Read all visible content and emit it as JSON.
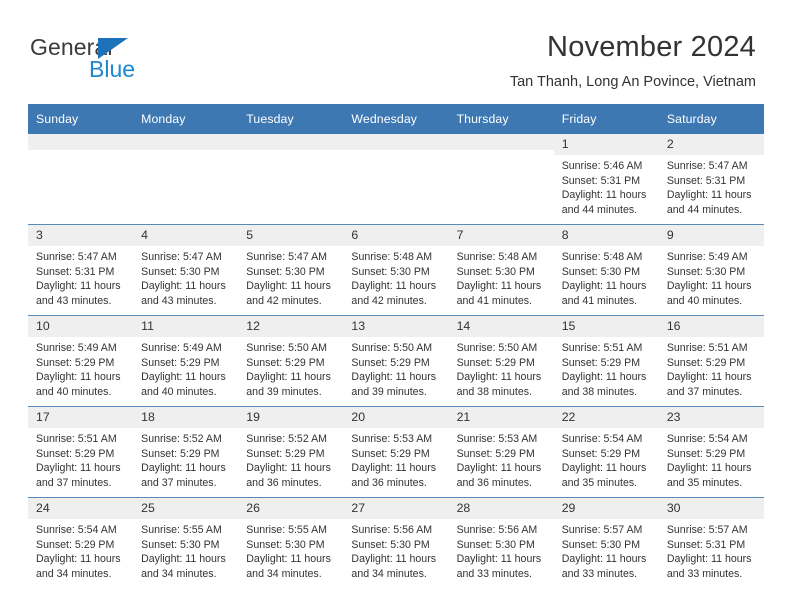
{
  "brand": {
    "name_part1": "General",
    "name_part2": "Blue",
    "triangle_color": "#1d71b8",
    "blue_color": "#1f86d0"
  },
  "header": {
    "title": "November 2024",
    "location": "Tan Thanh, Long An Povince, Vietnam"
  },
  "theme": {
    "header_blue": "#3d78b2",
    "row_divider": "#5b89b8",
    "daynum_band": "#efefef",
    "text": "#333333"
  },
  "calendar": {
    "weekday_headers": [
      "Sunday",
      "Monday",
      "Tuesday",
      "Wednesday",
      "Thursday",
      "Friday",
      "Saturday"
    ],
    "weeks": [
      [
        {
          "day": "",
          "empty": true
        },
        {
          "day": "",
          "empty": true
        },
        {
          "day": "",
          "empty": true
        },
        {
          "day": "",
          "empty": true
        },
        {
          "day": "",
          "empty": true
        },
        {
          "day": "1",
          "sunrise": "Sunrise: 5:46 AM",
          "sunset": "Sunset: 5:31 PM",
          "daylight_line1": "Daylight: 11 hours",
          "daylight_line2": "and 44 minutes."
        },
        {
          "day": "2",
          "sunrise": "Sunrise: 5:47 AM",
          "sunset": "Sunset: 5:31 PM",
          "daylight_line1": "Daylight: 11 hours",
          "daylight_line2": "and 44 minutes."
        }
      ],
      [
        {
          "day": "3",
          "sunrise": "Sunrise: 5:47 AM",
          "sunset": "Sunset: 5:31 PM",
          "daylight_line1": "Daylight: 11 hours",
          "daylight_line2": "and 43 minutes."
        },
        {
          "day": "4",
          "sunrise": "Sunrise: 5:47 AM",
          "sunset": "Sunset: 5:30 PM",
          "daylight_line1": "Daylight: 11 hours",
          "daylight_line2": "and 43 minutes."
        },
        {
          "day": "5",
          "sunrise": "Sunrise: 5:47 AM",
          "sunset": "Sunset: 5:30 PM",
          "daylight_line1": "Daylight: 11 hours",
          "daylight_line2": "and 42 minutes."
        },
        {
          "day": "6",
          "sunrise": "Sunrise: 5:48 AM",
          "sunset": "Sunset: 5:30 PM",
          "daylight_line1": "Daylight: 11 hours",
          "daylight_line2": "and 42 minutes."
        },
        {
          "day": "7",
          "sunrise": "Sunrise: 5:48 AM",
          "sunset": "Sunset: 5:30 PM",
          "daylight_line1": "Daylight: 11 hours",
          "daylight_line2": "and 41 minutes."
        },
        {
          "day": "8",
          "sunrise": "Sunrise: 5:48 AM",
          "sunset": "Sunset: 5:30 PM",
          "daylight_line1": "Daylight: 11 hours",
          "daylight_line2": "and 41 minutes."
        },
        {
          "day": "9",
          "sunrise": "Sunrise: 5:49 AM",
          "sunset": "Sunset: 5:30 PM",
          "daylight_line1": "Daylight: 11 hours",
          "daylight_line2": "and 40 minutes."
        }
      ],
      [
        {
          "day": "10",
          "sunrise": "Sunrise: 5:49 AM",
          "sunset": "Sunset: 5:29 PM",
          "daylight_line1": "Daylight: 11 hours",
          "daylight_line2": "and 40 minutes."
        },
        {
          "day": "11",
          "sunrise": "Sunrise: 5:49 AM",
          "sunset": "Sunset: 5:29 PM",
          "daylight_line1": "Daylight: 11 hours",
          "daylight_line2": "and 40 minutes."
        },
        {
          "day": "12",
          "sunrise": "Sunrise: 5:50 AM",
          "sunset": "Sunset: 5:29 PM",
          "daylight_line1": "Daylight: 11 hours",
          "daylight_line2": "and 39 minutes."
        },
        {
          "day": "13",
          "sunrise": "Sunrise: 5:50 AM",
          "sunset": "Sunset: 5:29 PM",
          "daylight_line1": "Daylight: 11 hours",
          "daylight_line2": "and 39 minutes."
        },
        {
          "day": "14",
          "sunrise": "Sunrise: 5:50 AM",
          "sunset": "Sunset: 5:29 PM",
          "daylight_line1": "Daylight: 11 hours",
          "daylight_line2": "and 38 minutes."
        },
        {
          "day": "15",
          "sunrise": "Sunrise: 5:51 AM",
          "sunset": "Sunset: 5:29 PM",
          "daylight_line1": "Daylight: 11 hours",
          "daylight_line2": "and 38 minutes."
        },
        {
          "day": "16",
          "sunrise": "Sunrise: 5:51 AM",
          "sunset": "Sunset: 5:29 PM",
          "daylight_line1": "Daylight: 11 hours",
          "daylight_line2": "and 37 minutes."
        }
      ],
      [
        {
          "day": "17",
          "sunrise": "Sunrise: 5:51 AM",
          "sunset": "Sunset: 5:29 PM",
          "daylight_line1": "Daylight: 11 hours",
          "daylight_line2": "and 37 minutes."
        },
        {
          "day": "18",
          "sunrise": "Sunrise: 5:52 AM",
          "sunset": "Sunset: 5:29 PM",
          "daylight_line1": "Daylight: 11 hours",
          "daylight_line2": "and 37 minutes."
        },
        {
          "day": "19",
          "sunrise": "Sunrise: 5:52 AM",
          "sunset": "Sunset: 5:29 PM",
          "daylight_line1": "Daylight: 11 hours",
          "daylight_line2": "and 36 minutes."
        },
        {
          "day": "20",
          "sunrise": "Sunrise: 5:53 AM",
          "sunset": "Sunset: 5:29 PM",
          "daylight_line1": "Daylight: 11 hours",
          "daylight_line2": "and 36 minutes."
        },
        {
          "day": "21",
          "sunrise": "Sunrise: 5:53 AM",
          "sunset": "Sunset: 5:29 PM",
          "daylight_line1": "Daylight: 11 hours",
          "daylight_line2": "and 36 minutes."
        },
        {
          "day": "22",
          "sunrise": "Sunrise: 5:54 AM",
          "sunset": "Sunset: 5:29 PM",
          "daylight_line1": "Daylight: 11 hours",
          "daylight_line2": "and 35 minutes."
        },
        {
          "day": "23",
          "sunrise": "Sunrise: 5:54 AM",
          "sunset": "Sunset: 5:29 PM",
          "daylight_line1": "Daylight: 11 hours",
          "daylight_line2": "and 35 minutes."
        }
      ],
      [
        {
          "day": "24",
          "sunrise": "Sunrise: 5:54 AM",
          "sunset": "Sunset: 5:29 PM",
          "daylight_line1": "Daylight: 11 hours",
          "daylight_line2": "and 34 minutes."
        },
        {
          "day": "25",
          "sunrise": "Sunrise: 5:55 AM",
          "sunset": "Sunset: 5:30 PM",
          "daylight_line1": "Daylight: 11 hours",
          "daylight_line2": "and 34 minutes."
        },
        {
          "day": "26",
          "sunrise": "Sunrise: 5:55 AM",
          "sunset": "Sunset: 5:30 PM",
          "daylight_line1": "Daylight: 11 hours",
          "daylight_line2": "and 34 minutes."
        },
        {
          "day": "27",
          "sunrise": "Sunrise: 5:56 AM",
          "sunset": "Sunset: 5:30 PM",
          "daylight_line1": "Daylight: 11 hours",
          "daylight_line2": "and 34 minutes."
        },
        {
          "day": "28",
          "sunrise": "Sunrise: 5:56 AM",
          "sunset": "Sunset: 5:30 PM",
          "daylight_line1": "Daylight: 11 hours",
          "daylight_line2": "and 33 minutes."
        },
        {
          "day": "29",
          "sunrise": "Sunrise: 5:57 AM",
          "sunset": "Sunset: 5:30 PM",
          "daylight_line1": "Daylight: 11 hours",
          "daylight_line2": "and 33 minutes."
        },
        {
          "day": "30",
          "sunrise": "Sunrise: 5:57 AM",
          "sunset": "Sunset: 5:31 PM",
          "daylight_line1": "Daylight: 11 hours",
          "daylight_line2": "and 33 minutes."
        }
      ]
    ]
  }
}
